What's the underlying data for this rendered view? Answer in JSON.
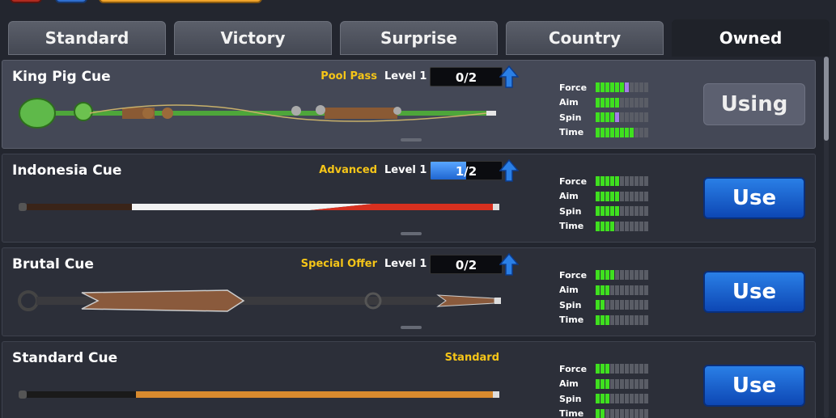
{
  "tabs": [
    {
      "label": "Standard"
    },
    {
      "label": "Victory"
    },
    {
      "label": "Surprise"
    },
    {
      "label": "Country"
    },
    {
      "label": "Owned"
    }
  ],
  "active_tab": "Owned",
  "stat_labels": {
    "force": "Force",
    "aim": "Aim",
    "spin": "Spin",
    "time": "Time"
  },
  "cues": [
    {
      "name": "King Pig Cue",
      "offer": "Pool Pass",
      "level": "Level 1",
      "progress": "0/2",
      "progress_fraction": 0.0,
      "stats": {
        "force": 6,
        "aim": 5,
        "spin": 4,
        "time": 8
      },
      "stats_upgrade": {
        "force": 1,
        "aim": 0,
        "spin": 1,
        "time": 0
      },
      "button": "Using",
      "selected": true,
      "colors": {
        "shaft": "#4ea63a",
        "accent": "#8a5a34"
      }
    },
    {
      "name": "Indonesia Cue",
      "offer": "Advanced",
      "level": "Level 1",
      "progress": "1/2",
      "progress_fraction": 0.5,
      "stats": {
        "force": 5,
        "aim": 5,
        "spin": 5,
        "time": 4
      },
      "button": "Use",
      "selected": false,
      "colors": {
        "butt": "#3a2418",
        "mid": "#f2f2f2",
        "tip": "#d7301f"
      }
    },
    {
      "name": "Brutal Cue",
      "offer": "Special Offer",
      "level": "Level 1",
      "progress": "0/2",
      "progress_fraction": 0.0,
      "stats": {
        "force": 4,
        "aim": 3,
        "spin": 2,
        "time": 3
      },
      "button": "Use",
      "selected": false,
      "colors": {
        "shaft": "#3a3a3e",
        "blade": "#8a5a3c"
      }
    },
    {
      "name": "Standard Cue",
      "offer": "Standard",
      "level": "",
      "progress": "",
      "stats": {
        "force": 3,
        "aim": 3,
        "spin": 3,
        "time": 2
      },
      "button": "Use",
      "selected": false,
      "colors": {
        "butt": "#1a1a1a",
        "shaft": "#d88a2e"
      }
    }
  ],
  "colors": {
    "accent_blue": "#1f66d1",
    "offer_yellow": "#f5c518",
    "stat_green": "#3fe01f",
    "stat_upgrade_purple": "#a67ce8"
  }
}
